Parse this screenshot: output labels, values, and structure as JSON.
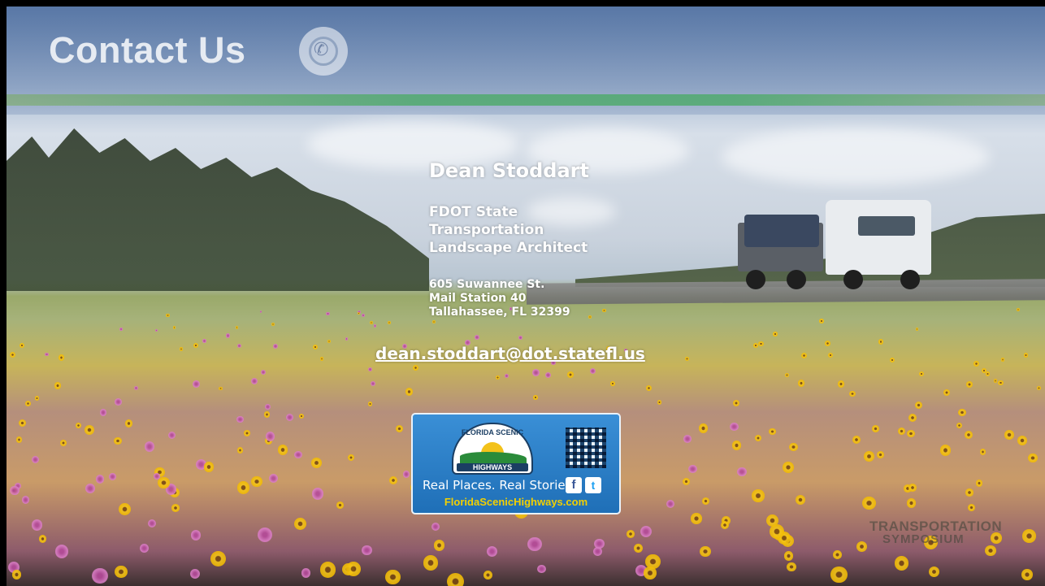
{
  "header": {
    "title": "Contact Us",
    "icon": "contact-phone-icon",
    "stripe_color": "#50aa6e"
  },
  "contact": {
    "name": "Dean Stoddart",
    "title_lines": [
      "FDOT State",
      "Transportation",
      "Landscape Architect"
    ],
    "address_lines": [
      "605 Suwannee St.",
      "Mail Station 40",
      "Tallahassee, FL 32399"
    ],
    "email": "dean.stoddart@dot.statefl.us"
  },
  "badge": {
    "sign_top": "FLORIDA SCENIC",
    "sign_bottom": "HIGHWAYS",
    "tagline": "Real Places. Real Stories..",
    "facebook_glyph": "f",
    "twitter_glyph": "t",
    "url": "FloridaScenicHighways.com",
    "background": "#2a80c8",
    "url_color": "#f3d000"
  },
  "watermark": {
    "line1": "TRANSPORTATION",
    "line2": "SYMPOSIUM"
  }
}
